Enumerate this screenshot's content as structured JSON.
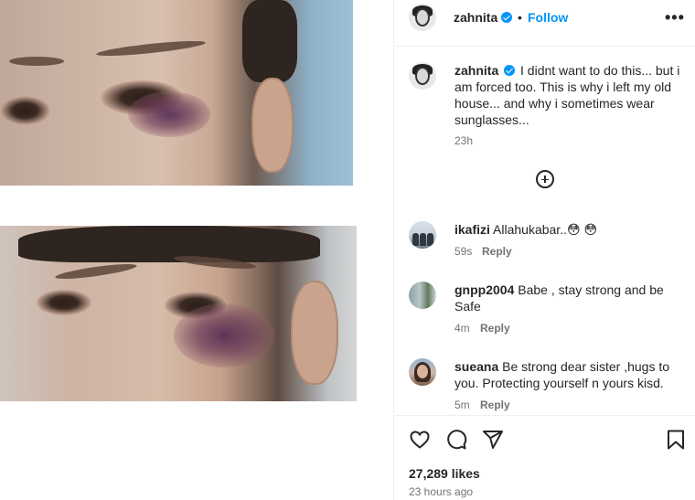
{
  "post": {
    "author": "zahnita",
    "follow_label": "Follow",
    "separator": "•",
    "more_label": "•••",
    "caption": {
      "username": "zahnita",
      "text": "I didnt want to do this... but i am forced too. This is why i left my old house... and why i sometimes wear sunglasses...",
      "time": "23h"
    },
    "comments": [
      {
        "username": "ikafizi",
        "text": "Allahukabar..😳 😳",
        "time": "59s",
        "reply_label": "Reply"
      },
      {
        "username": "gnpp2004",
        "text": "Babe , stay strong and be Safe",
        "time": "4m",
        "reply_label": "Reply"
      },
      {
        "username": "sueana",
        "text": "Be strong dear sister ,hugs to you. Protecting yourself n yours kisd.",
        "time": "5m",
        "reply_label": "Reply"
      }
    ],
    "likes": "27,289 likes",
    "posted_ago": "23 hours ago"
  },
  "colors": {
    "accent": "#0095f6",
    "text": "#262626",
    "muted": "#737373",
    "border": "#efefef"
  },
  "icons": [
    "more-options-icon",
    "verified-badge-icon",
    "load-more-comments-icon",
    "heart-icon",
    "comment-icon",
    "share-icon",
    "bookmark-icon"
  ]
}
